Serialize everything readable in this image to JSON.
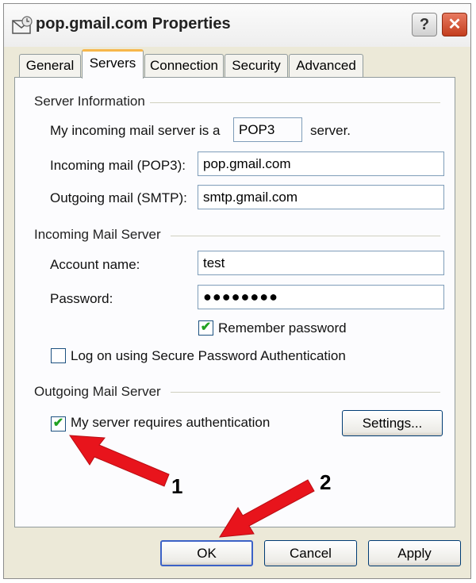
{
  "window": {
    "title": "pop.gmail.com Properties",
    "help_label": "?",
    "close_label": "✕"
  },
  "tabs": [
    {
      "label": "General"
    },
    {
      "label": "Servers",
      "active": true
    },
    {
      "label": "Connection"
    },
    {
      "label": "Security"
    },
    {
      "label": "Advanced"
    }
  ],
  "server_info": {
    "group_label": "Server Information",
    "incoming_type_prefix": "My incoming mail server is a",
    "incoming_type_value": "POP3",
    "incoming_type_suffix": "server.",
    "incoming_label": "Incoming mail (POP3):",
    "incoming_value": "pop.gmail.com",
    "outgoing_label": "Outgoing mail (SMTP):",
    "outgoing_value": "smtp.gmail.com"
  },
  "incoming_server": {
    "group_label": "Incoming Mail Server",
    "account_label": "Account name:",
    "account_value": "test",
    "password_label": "Password:",
    "password_value": "●●●●●●●●",
    "remember_label": "Remember password",
    "remember_checked": true,
    "spa_label": "Log on using Secure Password Authentication",
    "spa_checked": false
  },
  "outgoing_server": {
    "group_label": "Outgoing Mail Server",
    "auth_label": "My server requires authentication",
    "auth_checked": true,
    "settings_label": "Settings..."
  },
  "footer": {
    "ok_label": "OK",
    "cancel_label": "Cancel",
    "apply_label": "Apply"
  },
  "annotations": {
    "step1": "1",
    "step2": "2",
    "arrow_color": "#e8141c"
  },
  "check_glyph": "✔"
}
